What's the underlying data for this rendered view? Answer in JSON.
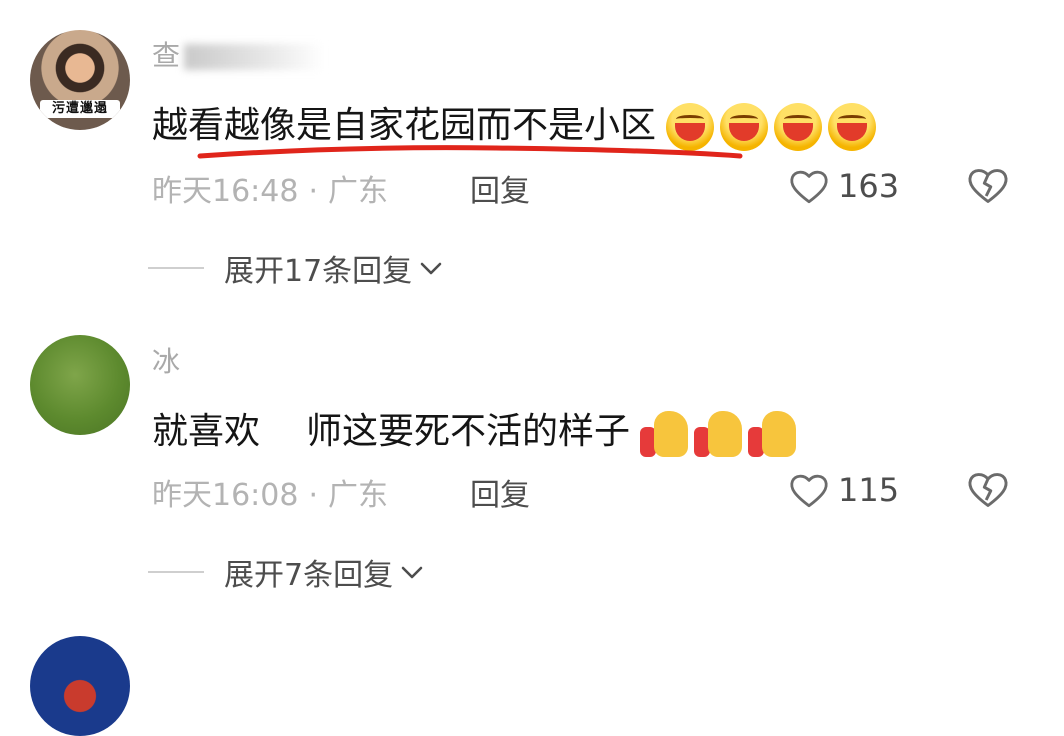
{
  "comments": [
    {
      "username": "查",
      "text": "越看越像是自家花园而不是小区",
      "emoji": [
        "laugh-cry-emoji",
        "laugh-cry-emoji",
        "laugh-cry-emoji",
        "laugh-cry-emoji"
      ],
      "avatar_badge": "污遭邋遢",
      "time": "昨天16:48",
      "location": "广东",
      "reply_label": "回复",
      "likes": "163",
      "expand_label": "展开17条回复"
    },
    {
      "username": "冰",
      "text": "就喜欢",
      "text_after": "师这要死不活的样子",
      "emoji": [
        "thumbs-up-emoji",
        "thumbs-up-emoji",
        "thumbs-up-emoji"
      ],
      "time": "昨天16:08",
      "location": "广东",
      "reply_label": "回复",
      "likes": "115",
      "expand_label": "展开7条回复"
    }
  ],
  "colors": {
    "underline": "#e0251b",
    "meta_text": "#b3b3b3",
    "action_text": "#4d4d4d"
  },
  "icons": [
    "heart-outline-icon",
    "broken-heart-icon",
    "chevron-down-icon"
  ]
}
